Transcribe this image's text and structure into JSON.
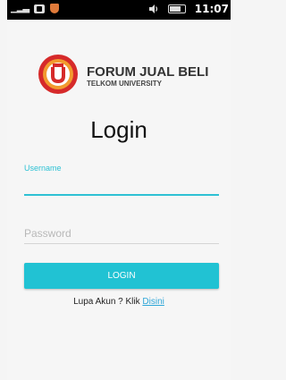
{
  "status_bar": {
    "time": "11:07",
    "icons": [
      "sim-signal-icon",
      "bbm-icon",
      "shield-icon",
      "sound-icon",
      "battery-icon"
    ]
  },
  "logo": {
    "title": "FORUM JUAL BELI",
    "subtitle": "TELKOM UNIVERSITY"
  },
  "page": {
    "title": "Login"
  },
  "form": {
    "username_label": "Username",
    "username_value": "",
    "password_placeholder": "Password",
    "password_value": "",
    "login_label": "LOGIN"
  },
  "footer": {
    "forgot_text": "Lupa Akun ? Klik",
    "forgot_link": "Disini"
  },
  "colors": {
    "accent": "#21c2d3",
    "link": "#2ea6d8",
    "logo_red": "#d62a2a",
    "logo_orange": "#f29a2e"
  }
}
